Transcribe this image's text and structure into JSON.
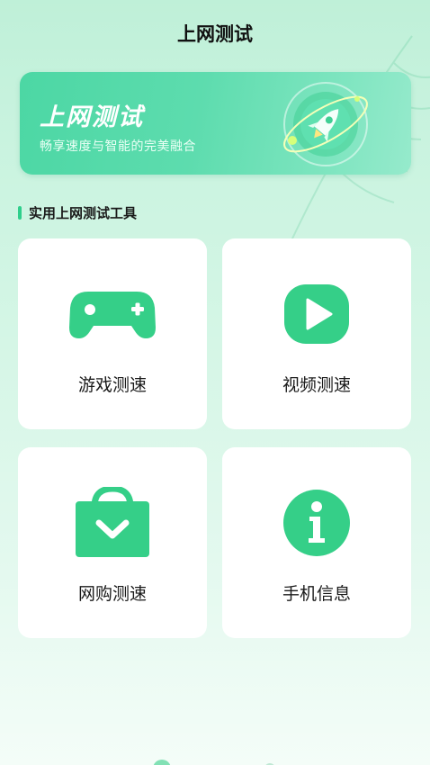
{
  "header": {
    "title": "上网测试"
  },
  "banner": {
    "title": "上网测试",
    "subtitle": "畅享速度与智能的完美融合",
    "art_icon": "rocket-icon"
  },
  "section": {
    "title": "实用上网测试工具"
  },
  "tools": [
    {
      "label": "游戏测速",
      "icon": "gamepad-icon"
    },
    {
      "label": "视频测速",
      "icon": "play-icon"
    },
    {
      "label": "网购测速",
      "icon": "shopping-bag-icon"
    },
    {
      "label": "手机信息",
      "icon": "info-icon"
    }
  ],
  "colors": {
    "accent": "#3fd08f",
    "banner": "#5ddcae",
    "card": "#ffffff"
  }
}
